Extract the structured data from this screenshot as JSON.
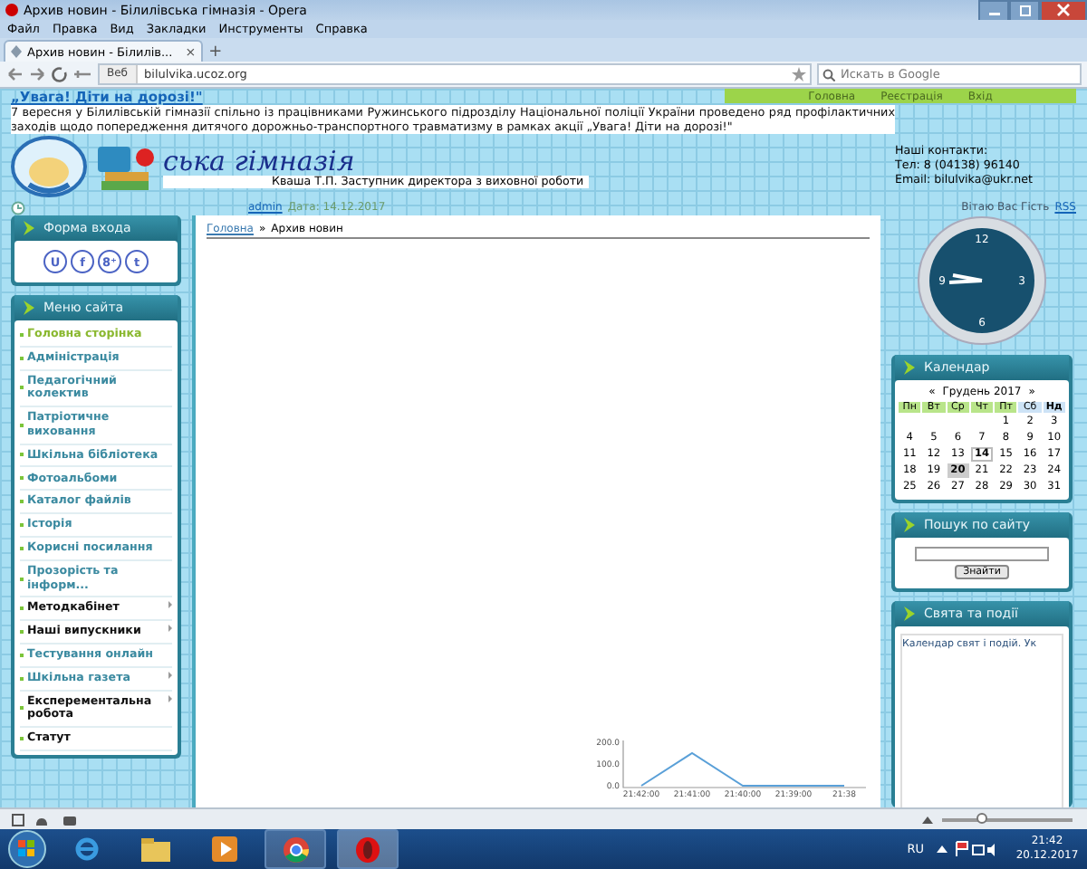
{
  "window": {
    "title": "Архив новин - Білилівська гімназія - Opera"
  },
  "menu_bar": [
    "Файл",
    "Правка",
    "Вид",
    "Закладки",
    "Инструменты",
    "Справка"
  ],
  "tabs": [
    {
      "label": "Архив новин - Білилів...",
      "selected": true,
      "close": "×"
    }
  ],
  "new_tab": "+",
  "address_bar": {
    "badge": "Веб",
    "url": "bilulvika.ucoz.org",
    "search_placeholder": "Искать в Google"
  },
  "site_nav": [
    {
      "label": "Головна"
    },
    {
      "label": "Реєстрація"
    },
    {
      "label": "Вхід"
    }
  ],
  "header": {
    "alert_title": "„Увага! Діти на дорозі!\"",
    "alert_text": "7 вересня у Білилівській гімназії спільно із працівниками Ружинського підрозділу Національної поліції України проведено ряд профілактичних заходів щодо попередження дитячого дорожньо-транспортного травматизму в рамках акції „Увага! Діти на дорозі!\"",
    "logo_text": "ська гімназія",
    "author_line": "Кваша Т.П. Заступник директора з виховної роботи",
    "contacts": [
      "Наші контакти:",
      "Тел: 8 (04138) 96140",
      "Email: bilulvika@ukr.net"
    ],
    "added_by": "admin",
    "date": "Дата: 14.12.2017",
    "greeting": "Вітаю Вас Гість",
    "rss": "RSS"
  },
  "login_panel": {
    "title": "Форма входа",
    "icons": [
      {
        "glyph": "U"
      },
      {
        "glyph": "f"
      },
      {
        "glyph": "8⁺"
      },
      {
        "glyph": "t"
      }
    ]
  },
  "site_menu": {
    "title": "Меню сайта",
    "items": [
      {
        "label": "Головна сторінка",
        "selected": true,
        "bold": false,
        "submenu": false
      },
      {
        "label": "Адміністрація",
        "selected": false,
        "bold": false,
        "submenu": false
      },
      {
        "label": "Педагогічний колектив",
        "selected": false,
        "bold": false,
        "submenu": false
      },
      {
        "label": "Патріотичне виховання",
        "selected": false,
        "bold": false,
        "submenu": false
      },
      {
        "label": "Шкільна бібліотека",
        "selected": false,
        "bold": false,
        "submenu": false
      },
      {
        "label": "Фотоальбоми",
        "selected": false,
        "bold": false,
        "submenu": false
      },
      {
        "label": "Каталог файлів",
        "selected": false,
        "bold": false,
        "submenu": false
      },
      {
        "label": "Історія",
        "selected": false,
        "bold": false,
        "submenu": false
      },
      {
        "label": "Корисні посилання",
        "selected": false,
        "bold": false,
        "submenu": false
      },
      {
        "label": "Прозорість та інформ...",
        "selected": false,
        "bold": false,
        "submenu": false
      },
      {
        "label": "Методкабінет",
        "selected": false,
        "bold": true,
        "submenu": true
      },
      {
        "label": "Наші випускники",
        "selected": false,
        "bold": true,
        "submenu": true
      },
      {
        "label": "Тестування онлайн",
        "selected": false,
        "bold": false,
        "submenu": false
      },
      {
        "label": "Шкільна газета",
        "selected": false,
        "bold": false,
        "submenu": true
      },
      {
        "label": "Експерементальна робота",
        "selected": false,
        "bold": true,
        "submenu": true
      },
      {
        "label": "Статут",
        "selected": false,
        "bold": true,
        "submenu": false
      }
    ]
  },
  "breadcrumb": {
    "home": "Головна",
    "separator": "»",
    "current": "Архив новин"
  },
  "clock": {
    "numbers": [
      "12",
      "3",
      "6",
      "9"
    ]
  },
  "calendar": {
    "title": "Календар",
    "prev": "«",
    "month": "Грудень 2017",
    "next": "»",
    "weekdays": [
      {
        "label": "Пн",
        "kind": "work"
      },
      {
        "label": "Вт",
        "kind": "work"
      },
      {
        "label": "Ср",
        "kind": "work"
      },
      {
        "label": "Чт",
        "kind": "work"
      },
      {
        "label": "Пт",
        "kind": "work"
      },
      {
        "label": "Сб",
        "kind": "sat"
      },
      {
        "label": "Нд",
        "kind": "sun"
      }
    ],
    "weeks": [
      [
        {
          "kind": "blank"
        },
        {
          "kind": "blank"
        },
        {
          "kind": "blank"
        },
        {
          "kind": "blank"
        },
        {
          "kind": "day",
          "day": "1",
          "today": false,
          "marked": false
        },
        {
          "kind": "day",
          "day": "2",
          "today": false,
          "marked": false
        },
        {
          "kind": "day",
          "day": "3",
          "today": false,
          "marked": false
        }
      ],
      [
        {
          "kind": "day",
          "day": "4",
          "today": false,
          "marked": false
        },
        {
          "kind": "day",
          "day": "5",
          "today": false,
          "marked": false
        },
        {
          "kind": "day",
          "day": "6",
          "today": false,
          "marked": false
        },
        {
          "kind": "day",
          "day": "7",
          "today": false,
          "marked": false
        },
        {
          "kind": "day",
          "day": "8",
          "today": false,
          "marked": false
        },
        {
          "kind": "day",
          "day": "9",
          "today": false,
          "marked": false
        },
        {
          "kind": "day",
          "day": "10",
          "today": false,
          "marked": false
        }
      ],
      [
        {
          "kind": "day",
          "day": "11",
          "today": false,
          "marked": false
        },
        {
          "kind": "day",
          "day": "12",
          "today": false,
          "marked": false
        },
        {
          "kind": "day",
          "day": "13",
          "today": false,
          "marked": false
        },
        {
          "kind": "day",
          "day": "14",
          "today": false,
          "marked": true
        },
        {
          "kind": "day",
          "day": "15",
          "today": false,
          "marked": false
        },
        {
          "kind": "day",
          "day": "16",
          "today": false,
          "marked": false
        },
        {
          "kind": "day",
          "day": "17",
          "today": false,
          "marked": false
        }
      ],
      [
        {
          "kind": "day",
          "day": "18",
          "today": false,
          "marked": false
        },
        {
          "kind": "day",
          "day": "19",
          "today": false,
          "marked": false
        },
        {
          "kind": "day",
          "day": "20",
          "today": true,
          "marked": false
        },
        {
          "kind": "day",
          "day": "21",
          "today": false,
          "marked": false
        },
        {
          "kind": "day",
          "day": "22",
          "today": false,
          "marked": false
        },
        {
          "kind": "day",
          "day": "23",
          "today": false,
          "marked": false
        },
        {
          "kind": "day",
          "day": "24",
          "today": false,
          "marked": false
        }
      ],
      [
        {
          "kind": "day",
          "day": "25",
          "today": false,
          "marked": false
        },
        {
          "kind": "day",
          "day": "26",
          "today": false,
          "marked": false
        },
        {
          "kind": "day",
          "day": "27",
          "today": false,
          "marked": false
        },
        {
          "kind": "day",
          "day": "28",
          "today": false,
          "marked": false
        },
        {
          "kind": "day",
          "day": "29",
          "today": false,
          "marked": false
        },
        {
          "kind": "day",
          "day": "30",
          "today": false,
          "marked": false
        },
        {
          "kind": "day",
          "day": "31",
          "today": false,
          "marked": false
        }
      ]
    ]
  },
  "search_panel": {
    "title": "Пошук по сайту",
    "button": "Знайти"
  },
  "events_panel": {
    "title": "Свята та події",
    "text": "Календар свят і подій. Ук"
  },
  "traffic_graph": {
    "chart_data": {
      "type": "line",
      "categories": [
        "21:42:00",
        "21:41:00",
        "21:40:00",
        "21:39:00",
        "21:38"
      ],
      "yticks": [
        {
          "value": 0,
          "label": "0.0"
        },
        {
          "value": 100,
          "label": "100.0"
        },
        {
          "value": 200,
          "label": "200.0"
        }
      ],
      "ylim": [
        0,
        200
      ],
      "series": [
        {
          "color": "#5aa0d8",
          "values": [
            0,
            150,
            0,
            0,
            0
          ]
        }
      ]
    }
  },
  "status_bar": {
    "zoom": {
      "level": 0.3
    }
  },
  "taskbar": {
    "language": "RU",
    "time": "21:42",
    "date": "20.12.2017"
  }
}
